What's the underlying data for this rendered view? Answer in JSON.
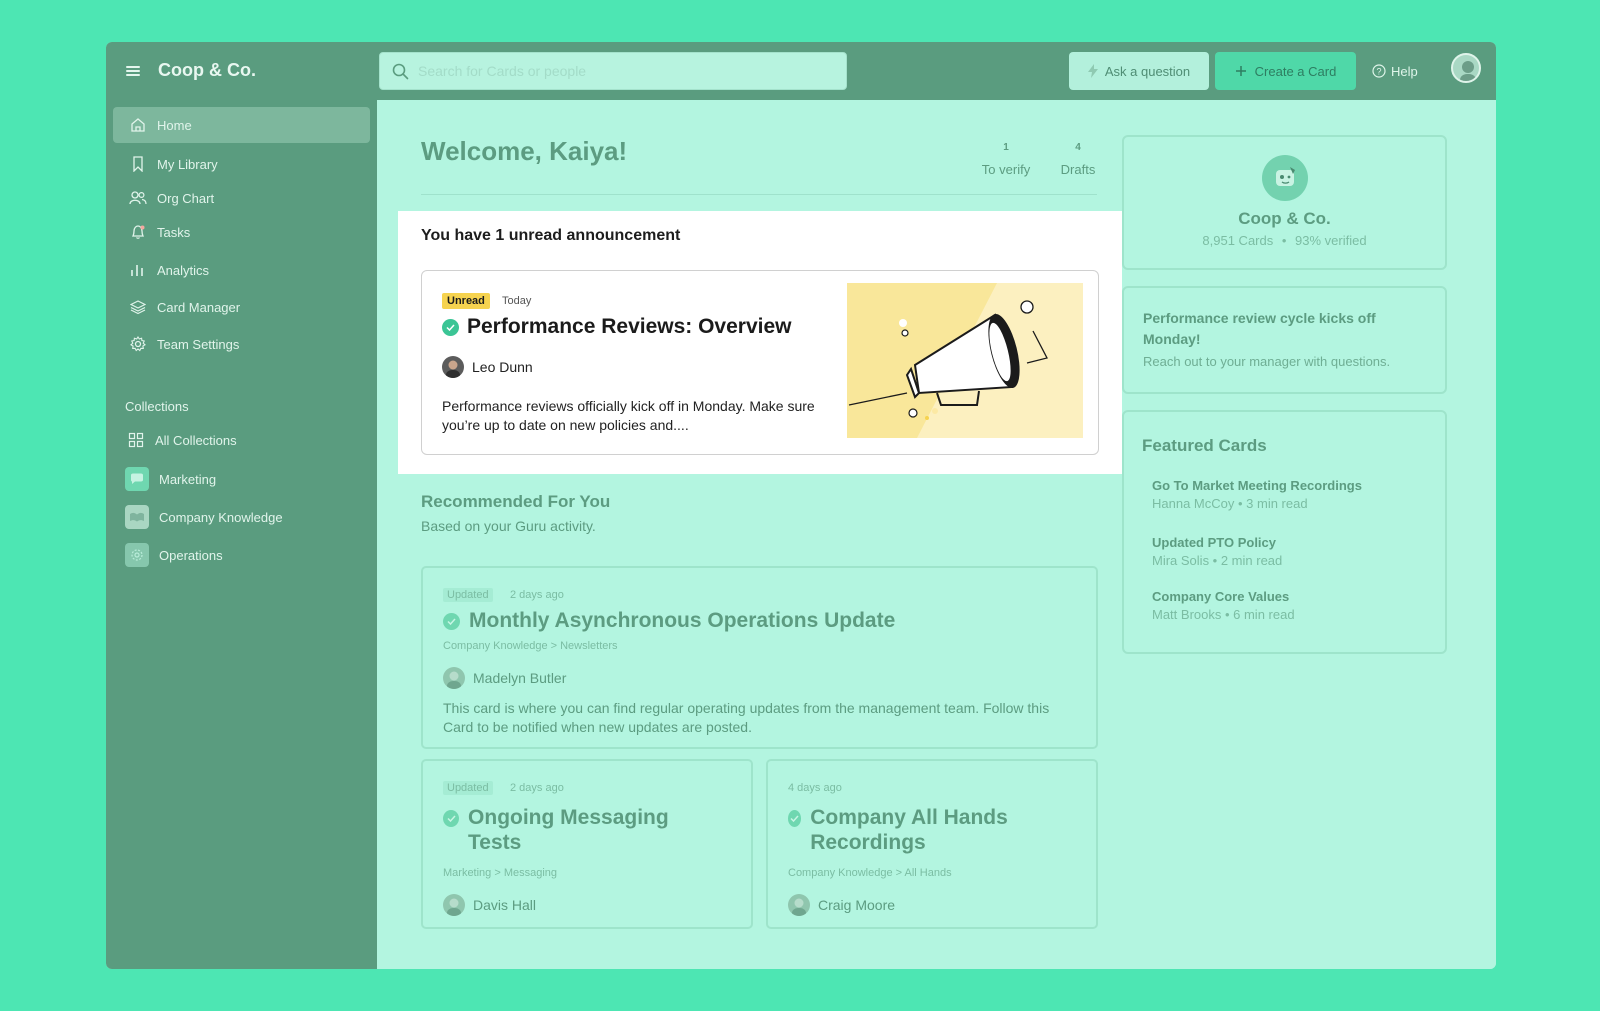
{
  "app": {
    "name": "Coop & Co."
  },
  "search": {
    "placeholder": "Search for Cards or people"
  },
  "header": {
    "ask_label": "Ask a question",
    "create_label": "Create a Card",
    "help_label": "Help"
  },
  "sidebar": {
    "items": [
      {
        "label": "Home",
        "icon": "home-icon"
      },
      {
        "label": "My Library",
        "icon": "bookmark-icon"
      },
      {
        "label": "Org Chart",
        "icon": "people-icon"
      },
      {
        "label": "Tasks",
        "icon": "bell-icon"
      },
      {
        "label": "Analytics",
        "icon": "bar-chart-icon"
      },
      {
        "label": "Card Manager",
        "icon": "layers-icon"
      },
      {
        "label": "Team Settings",
        "icon": "gear-icon"
      }
    ],
    "collections_label": "Collections",
    "collections": [
      {
        "label": "All Collections",
        "icon": "grid-icon"
      },
      {
        "label": "Marketing",
        "icon": "chat-icon"
      },
      {
        "label": "Company Knowledge",
        "icon": "book-icon"
      },
      {
        "label": "Operations",
        "icon": "cog-icon"
      }
    ]
  },
  "main": {
    "welcome": "Welcome, Kaiya!",
    "stats": [
      {
        "value": "1",
        "label": "To verify"
      },
      {
        "value": "4",
        "label": "Drafts"
      }
    ],
    "announcement": {
      "header": "You have 1 unread announcement",
      "badge": "Unread",
      "when": "Today",
      "title": "Performance Reviews: Overview",
      "author": "Leo Dunn",
      "body": "Performance reviews officially kick off in Monday. Make sure you’re up to date on new policies and...."
    },
    "recommended": {
      "title": "Recommended For You",
      "subtitle": "Based on your Guru activity.",
      "cards": [
        {
          "badge": "Updated",
          "ago": "2 days ago",
          "title": "Monthly Asynchronous Operations Update",
          "path": "Company Knowledge > Newsletters",
          "author": "Madelyn Butler",
          "body": "This card is where you can find regular operating updates from the management team. Follow this Card to be notified when new updates are posted."
        },
        {
          "badge": "Updated",
          "ago": "2 days ago",
          "title": "Ongoing Messaging Tests",
          "path": "Marketing > Messaging",
          "author": "Davis Hall"
        },
        {
          "ago": "4 days ago",
          "title": "Company All Hands Recordings",
          "path": "Company Knowledge > All Hands",
          "author": "Craig Moore"
        }
      ]
    }
  },
  "right": {
    "org": {
      "name": "Coop & Co.",
      "cards": "8,951 Cards",
      "sep": "•",
      "verified": "93% verified"
    },
    "notice": {
      "title": "Performance review cycle kicks off Monday!",
      "subtitle": "Reach out to your manager with questions."
    },
    "featured": {
      "title": "Featured Cards",
      "items": [
        {
          "title": "Go To Market Meeting Recordings",
          "meta": "Hanna McCoy • 3 min read"
        },
        {
          "title": "Updated PTO Policy",
          "meta": "Mira Solis • 2 min read"
        },
        {
          "title": "Company Core Values",
          "meta": "Matt Brooks • 6 min read"
        }
      ]
    }
  },
  "colors": {
    "outer_bg": "#4de6b3",
    "sidebar": "#5a9c7f",
    "main_bg": "#b3f5e0",
    "accent": "#3bc595",
    "unread_badge": "#f6d34f"
  }
}
